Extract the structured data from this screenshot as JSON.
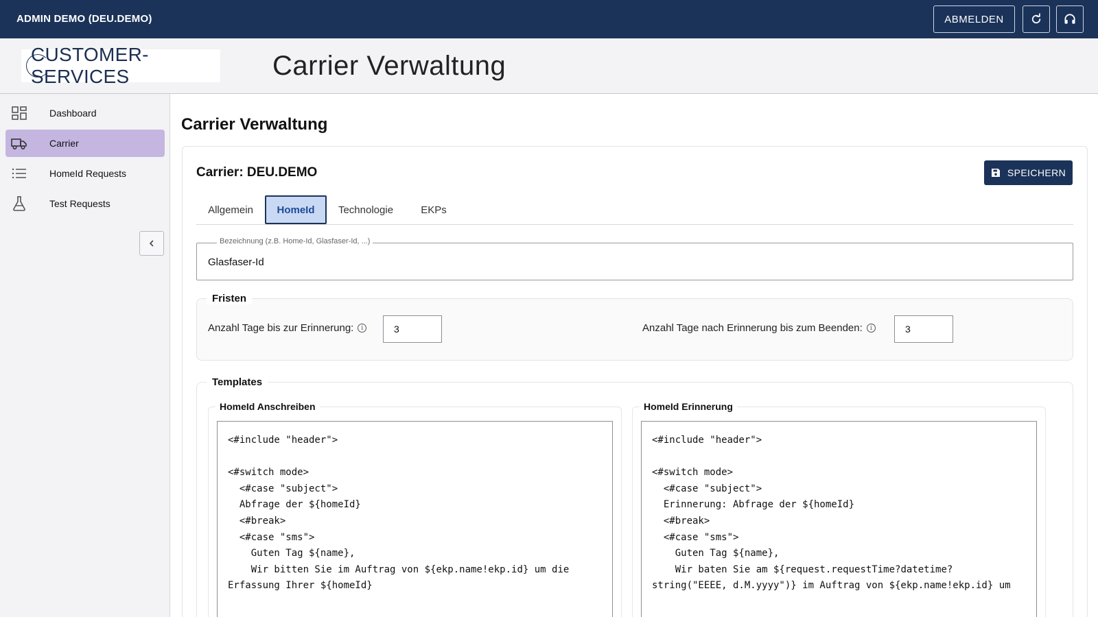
{
  "topbar": {
    "user": "ADMIN DEMO (DEU.DEMO)",
    "logout_label": "ABMELDEN",
    "refresh_icon": "refresh-icon",
    "support_icon": "headset-icon"
  },
  "header": {
    "logo_text": "CUSTOMER-SERVICES",
    "title": "Carrier Verwaltung"
  },
  "sidebar": {
    "items": [
      {
        "label": "Dashboard",
        "icon": "dashboard-icon"
      },
      {
        "label": "Carrier",
        "icon": "truck-icon",
        "active": true
      },
      {
        "label": "HomeId Requests",
        "icon": "list-icon"
      },
      {
        "label": "Test Requests",
        "icon": "flask-icon"
      }
    ],
    "collapse_icon": "chevron-left-icon"
  },
  "main": {
    "title": "Carrier Verwaltung",
    "card_title": "Carrier: DEU.DEMO",
    "save_label": "SPEICHERN",
    "tabs": [
      {
        "label": "Allgemein"
      },
      {
        "label": "HomeId",
        "active": true
      },
      {
        "label": "Technologie"
      },
      {
        "label": "EKPs"
      }
    ],
    "bezeichnung": {
      "label": "Bezeichnung (z.B. Home-Id, Glasfaser-Id, ...)",
      "value": "Glasfaser-Id"
    },
    "fristen": {
      "title": "Fristen",
      "reminder_label": "Anzahl Tage bis zur Erinnerung:",
      "reminder_value": "3",
      "end_label": "Anzahl Tage nach Erinnerung bis zum Beenden:",
      "end_value": "3"
    },
    "templates": {
      "title": "Templates",
      "anschreiben": {
        "title": "HomeId Anschreiben",
        "code": "<#include \"header\">\n\n<#switch mode>\n  <#case \"subject\">\n  Abfrage der ${homeId}\n  <#break>\n  <#case \"sms\">\n    Guten Tag ${name},\n    Wir bitten Sie im Auftrag von ${ekp.name!ekp.id} um die\nErfassung Ihrer ${homeId}"
      },
      "erinnerung": {
        "title": "HomeId Erinnerung",
        "code": "<#include \"header\">\n\n<#switch mode>\n  <#case \"subject\">\n  Erinnerung: Abfrage der ${homeId}\n  <#break>\n  <#case \"sms\">\n    Guten Tag ${name},\n    Wir baten Sie am ${request.requestTime?datetime?\nstring(\"EEEE, d.M.yyyy\")} im Auftrag von ${ekp.name!ekp.id} um"
      }
    }
  },
  "colors": {
    "primary": "#1b3359",
    "active_nav": "#c4b6e0",
    "active_tab_bg": "#c9d9f3"
  }
}
